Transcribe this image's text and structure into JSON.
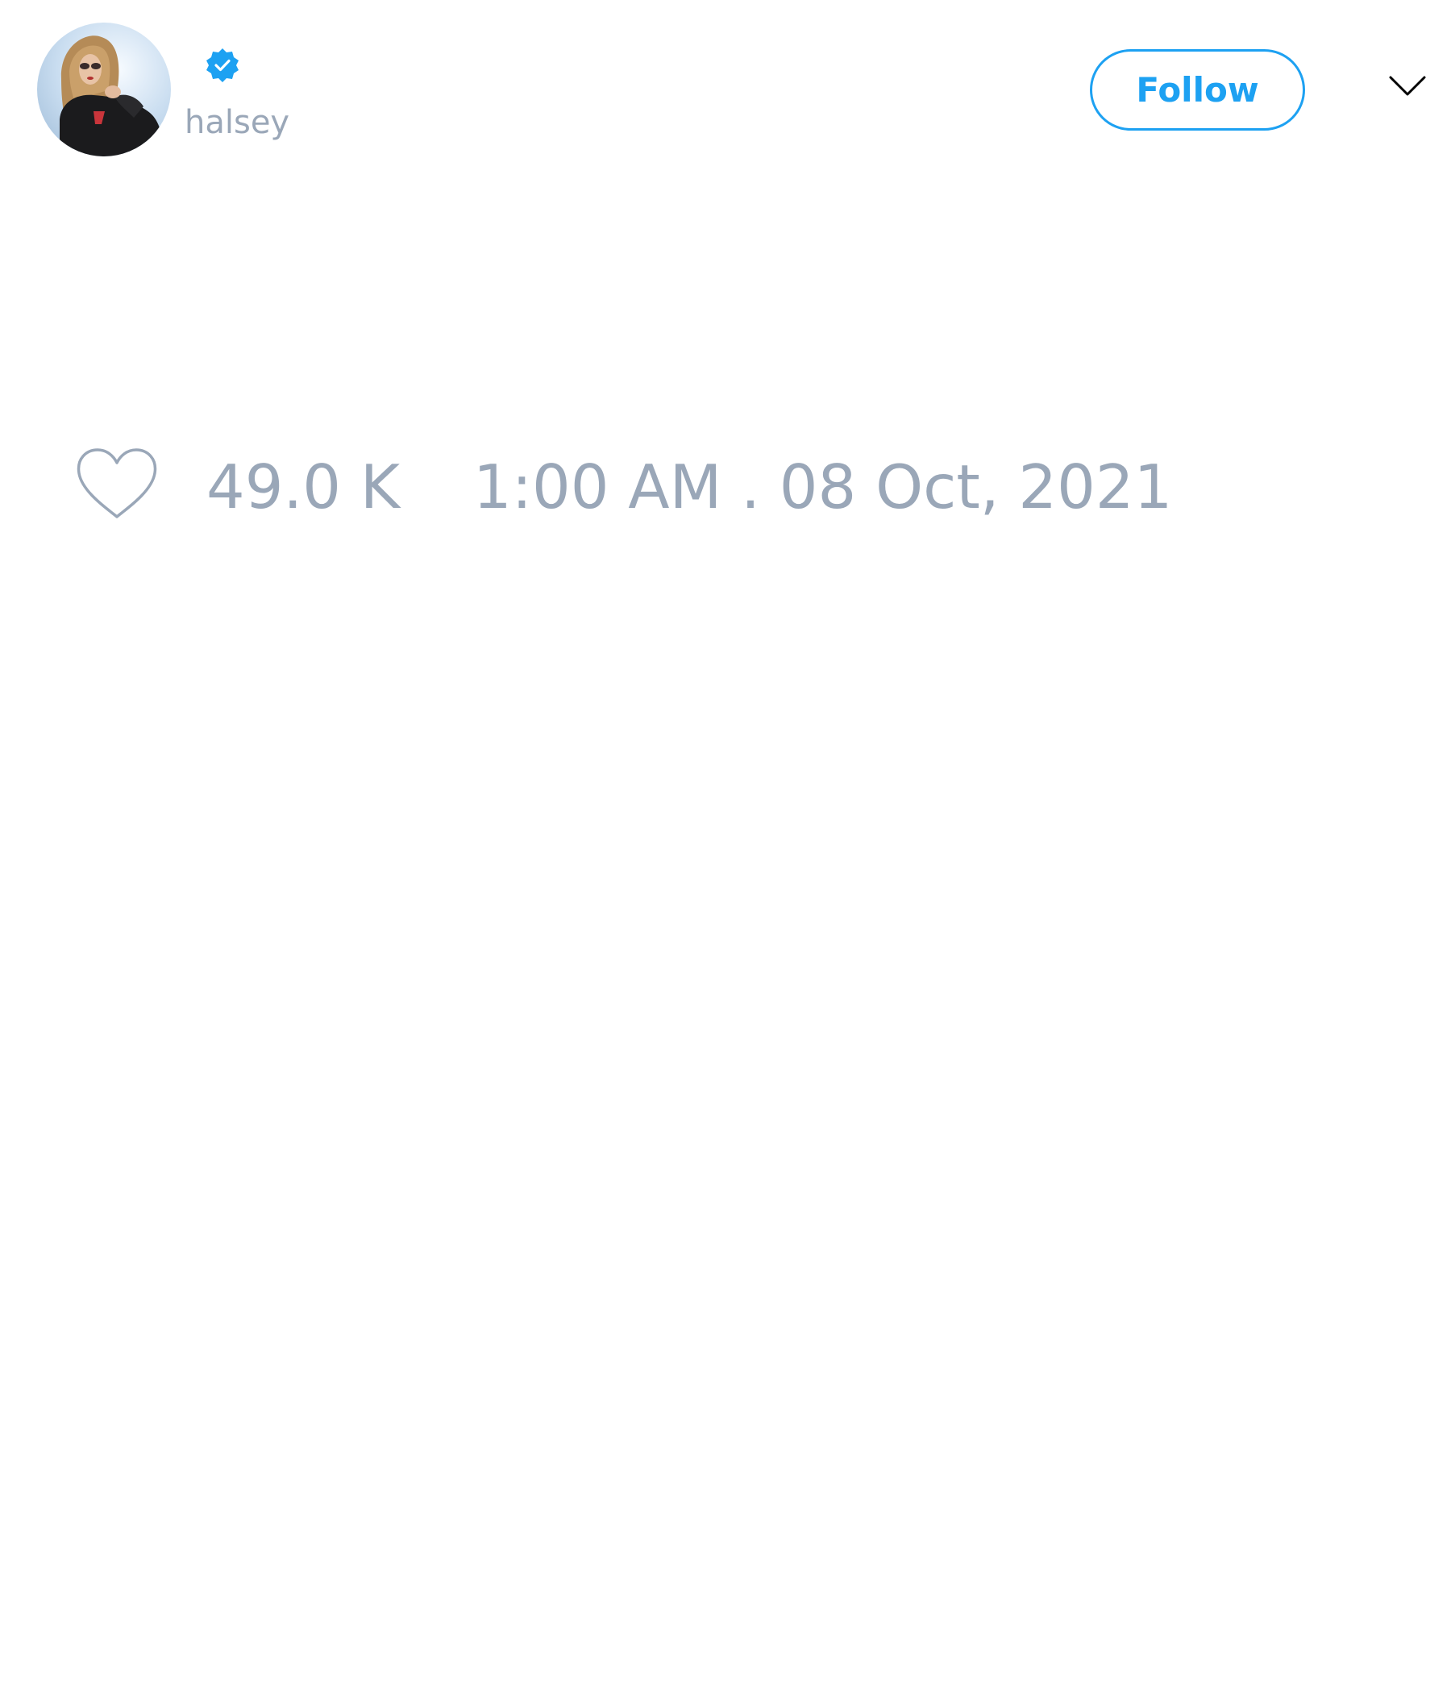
{
  "header": {
    "handle": "halsey",
    "verified": true,
    "follow_label": "Follow"
  },
  "stats": {
    "likes": "49.0 K",
    "timestamp": "1:00 AM . 08 Oct, 2021"
  },
  "icons": {
    "verified": "verified-badge-icon",
    "menu": "chevron-down-icon",
    "like": "heart-icon"
  },
  "colors": {
    "accent": "#1da1f2",
    "muted_text": "#9aa7b8",
    "background": "#ffffff"
  }
}
